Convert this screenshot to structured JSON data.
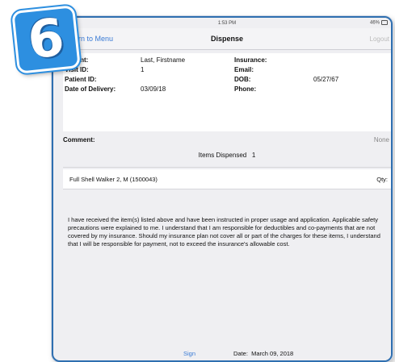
{
  "step_badge": "6",
  "status_bar": {
    "left": "●●",
    "time": "1:53 PM",
    "battery": "46%"
  },
  "nav": {
    "back_label": "Return to Menu",
    "title": "Dispense",
    "right_label": "Logout"
  },
  "patient": {
    "patient_label": "Patient:",
    "patient_value": "Last, Firstname",
    "visit_label": "Visit ID:",
    "visit_value": "1",
    "pid_label": "Patient ID:",
    "pid_value": "",
    "delivery_label": "Date of Delivery:",
    "delivery_value": "03/09/18",
    "insurance_label": "Insurance:",
    "insurance_value": "",
    "email_label": "Email:",
    "email_value": "",
    "dob_label": "DOB:",
    "dob_value": "05/27/67",
    "phone_label": "Phone:",
    "phone_value": ""
  },
  "comment": {
    "label": "Comment:",
    "value": "None"
  },
  "items": {
    "label": "Items Dispensed",
    "count": "1"
  },
  "product": {
    "name": "Full Shell Walker 2, M (1500043)",
    "qty_label": "Qty:"
  },
  "statement": "I have received the item(s) listed above and have been instructed in proper usage and application. Applicable safety precautions were explained to me. I understand that I am responsible for deductibles and co-payments that are not covered by my insurance. Should my insurance plan not cover all or part of the charges for these items, I understand that I will be responsible for payment, not to exceed the insurance's allowable cost.",
  "footer": {
    "sign_label": "Sign",
    "date_label": "Date:",
    "date_value": "March 09, 2018"
  }
}
